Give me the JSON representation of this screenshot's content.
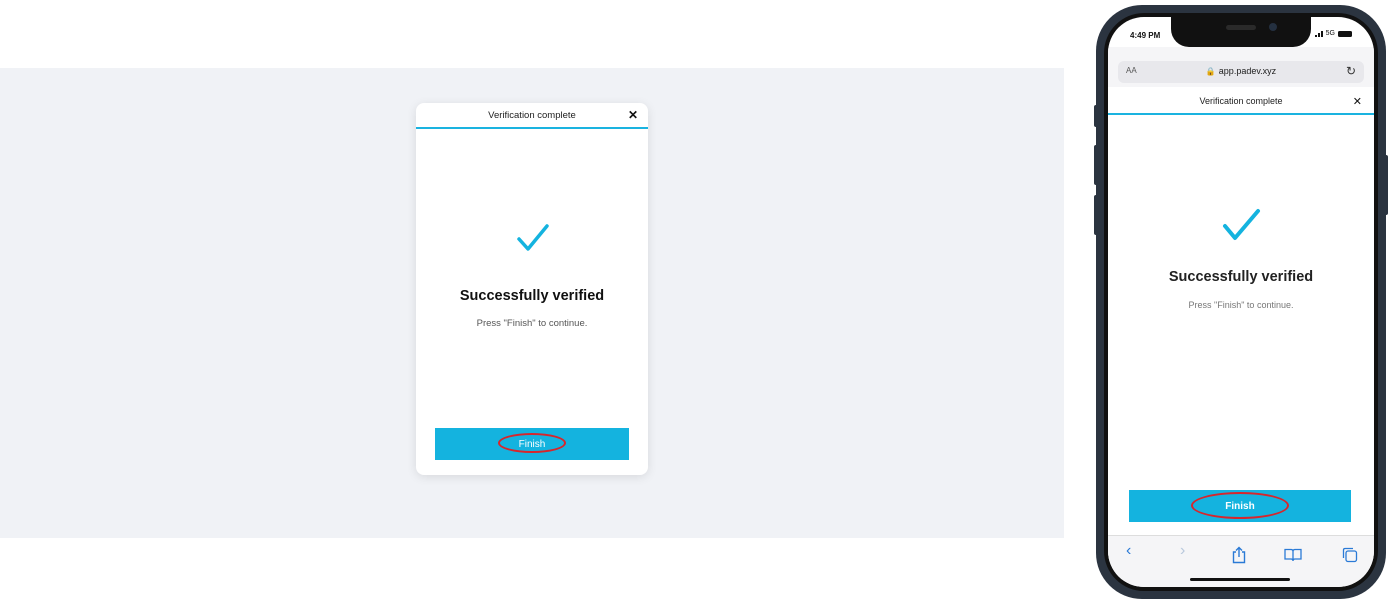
{
  "colors": {
    "accent": "#14b3df",
    "annotation": "#d7262c",
    "desktop_bg": "#f0f2f6"
  },
  "desktop": {
    "modal": {
      "title": "Verification complete",
      "close_symbol": "✕",
      "heading": "Successfully verified",
      "subtext": "Press \"Finish\" to continue.",
      "finish_label": "Finish"
    }
  },
  "mobile": {
    "status_bar": {
      "time": "4:49 PM",
      "network": "5G"
    },
    "browser": {
      "text_size_label": "AA",
      "url": "app.padev.xyz",
      "lock_symbol": "🔒",
      "reload_symbol": "↻"
    },
    "modal": {
      "title": "Verification complete",
      "close_symbol": "✕",
      "heading": "Successfully verified",
      "subtext": "Press \"Finish\" to continue.",
      "finish_label": "Finish"
    },
    "toolbar": {
      "back_symbol": "‹",
      "forward_symbol": "›",
      "share_icon": "share-icon",
      "bookmarks_icon": "book-icon",
      "tabs_icon": "tabs-icon"
    }
  }
}
